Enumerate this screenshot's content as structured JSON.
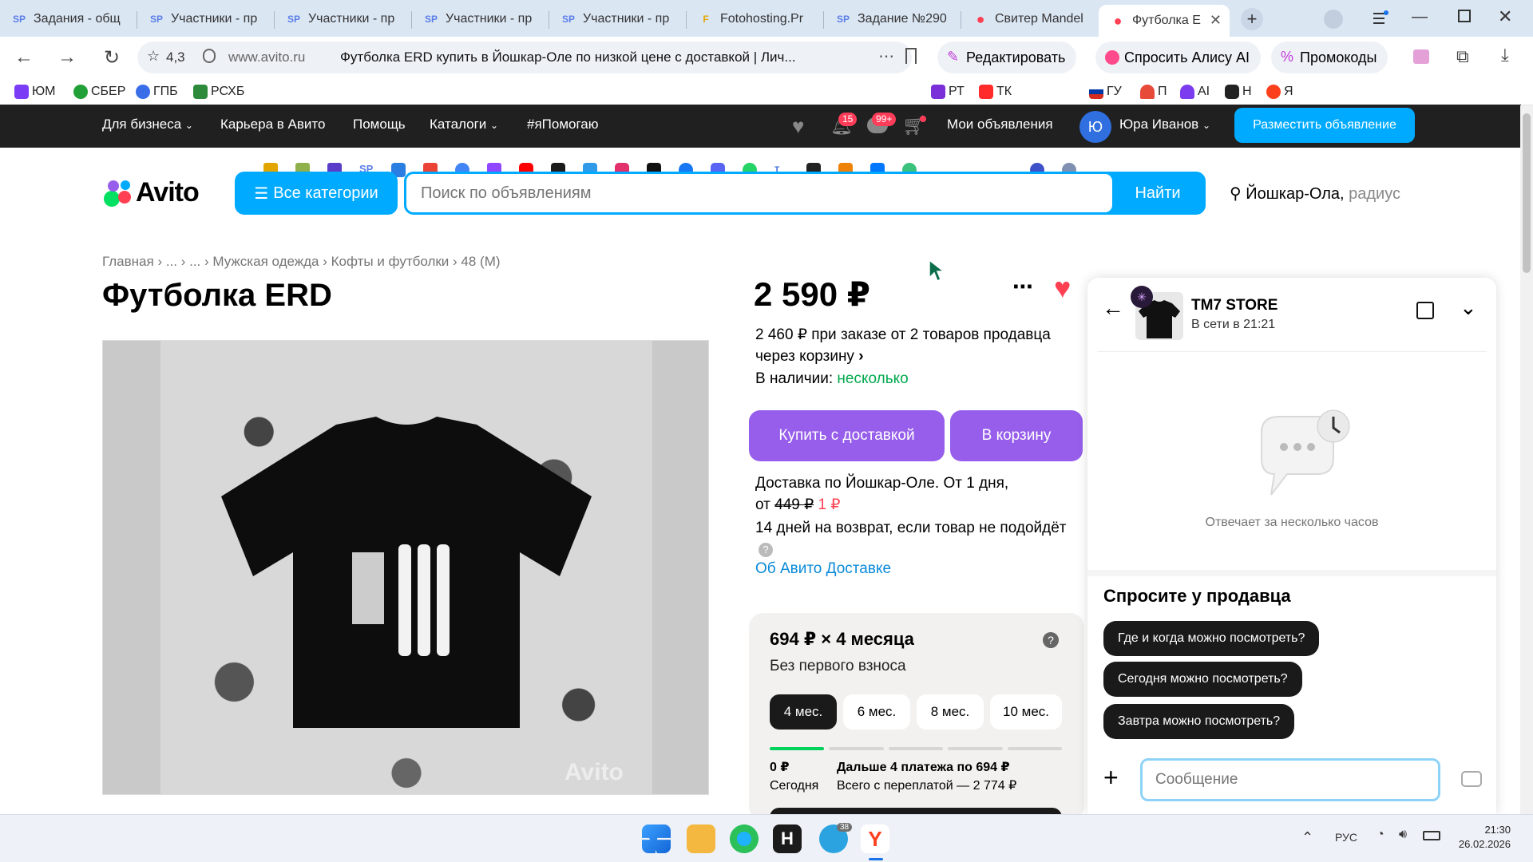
{
  "tabs": [
    {
      "icon": "SP",
      "title": "Задания - общ",
      "active": false
    },
    {
      "icon": "SP",
      "title": "Участники - пр",
      "active": false
    },
    {
      "icon": "SP",
      "title": "Участники - пр",
      "active": false
    },
    {
      "icon": "SP",
      "title": "Участники - пр",
      "active": false
    },
    {
      "icon": "SP",
      "title": "Участники - пр",
      "active": false
    },
    {
      "icon": "F",
      "title": "Fotohosting.Pr",
      "active": false
    },
    {
      "icon": "SP",
      "title": "Задание №290",
      "active": false
    },
    {
      "icon": "●",
      "title": "Свитер Mandel",
      "active": false
    },
    {
      "icon": "●",
      "title": "Футболка Е",
      "active": true
    }
  ],
  "address": {
    "rating": "4,3",
    "domain": "www.avito.ru",
    "page_title": "Футболка ERD купить в Йошкар-Оле по низкой цене с доставкой | Лич...",
    "edit_label": "Редактировать",
    "alice_label": "Спросить Алису AI",
    "promo_label": "Промокоды"
  },
  "bookmarks": [
    "ЮМ",
    "СБЕР",
    "ГПБ",
    "РСХБ",
    "РТ",
    "ТК",
    "ГУ",
    "П",
    "AI",
    "Н",
    "Я"
  ],
  "topnav": {
    "business": "Для бизнеса",
    "career": "Карьера в Авито",
    "help": "Помощь",
    "catalogs": "Каталоги",
    "tag": "#яПомогаю",
    "notif_count": "15",
    "msg_count": "99+",
    "my_ads": "Мои объявления",
    "avatar_letter": "Ю",
    "user_name": "Юра Иванов",
    "post_button": "Разместить объявление"
  },
  "header": {
    "logo": "Avito",
    "categories_button": "Все категории",
    "search_placeholder": "Поиск по объявлениям",
    "search_button": "Найти",
    "city": "Йошкар-Ола,",
    "radius": "радиус"
  },
  "breadcrumbs": [
    "Главная",
    "...",
    "...",
    "Мужская одежда",
    "Кофты и футболки",
    "48 (M)"
  ],
  "product": {
    "title": "Футболка ERD",
    "price": "2 590 ₽",
    "bulk_line1": "2 460 ₽ при заказе от 2 товаров продавца",
    "bulk_line2": "через корзину",
    "stock_label": "В наличии:",
    "stock_value": "несколько",
    "buy_button": "Купить с доставкой",
    "cart_button": "В корзину",
    "delivery_line1": "Доставка по Йошкар-Оле. От 1 дня,",
    "delivery_from": "от",
    "delivery_old": "449 ₽",
    "delivery_new": "1 ₽",
    "return_text": "14 дней на возврат, если товар не подойдёт",
    "about_delivery": "Об Авито Доставке",
    "watermark": "Avito"
  },
  "installment": {
    "title": "694 ₽ × 4 месяца",
    "subtitle": "Без первого взноса",
    "options": [
      "4 мес.",
      "6 мес.",
      "8 мес.",
      "10 мес."
    ],
    "selected": "4 мес.",
    "today_amount": "0 ₽",
    "today_label": "Сегодня",
    "next_text": "Дальше 4 платежа по 694 ₽",
    "total_text": "Всего с переплатой — 2 774 ₽"
  },
  "chat": {
    "seller_name": "TM7 STORE",
    "status": "В сети в 21:21",
    "reply_time": "Отвечает за несколько часов",
    "ask_title": "Спросите у продавца",
    "questions": [
      "Где и когда можно посмотреть?",
      "Сегодня можно посмотреть?",
      "Завтра можно посмотреть?"
    ],
    "message_placeholder": "Сообщение"
  },
  "taskbar": {
    "language": "РУС",
    "time": "21:30",
    "date": "26.02.2026",
    "telegram_badge": "38"
  },
  "colors": {
    "avito_blue": "#00aaff",
    "purple": "#965eeb",
    "green": "#02d15c",
    "red": "#ff4053",
    "dark": "#202020"
  }
}
